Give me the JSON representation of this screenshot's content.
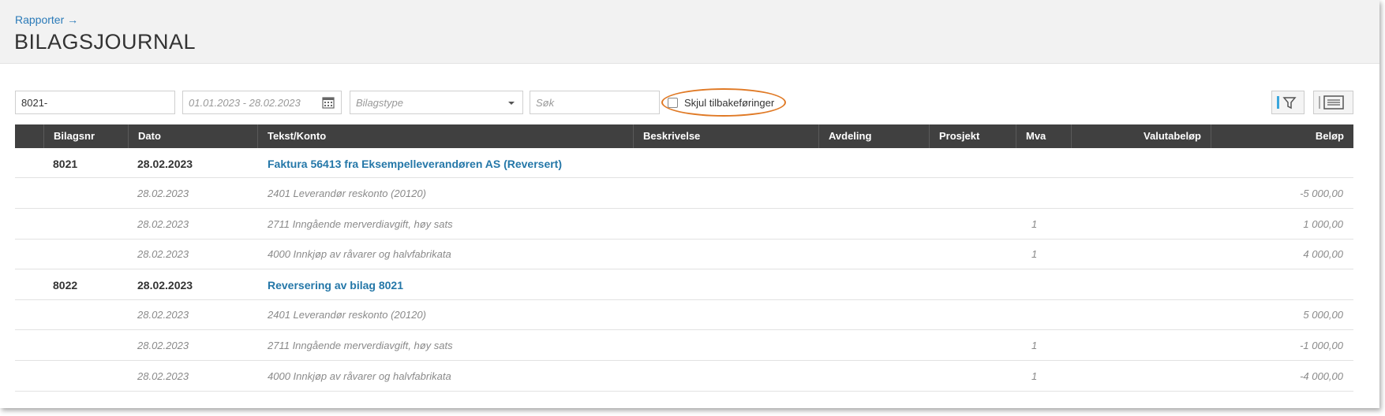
{
  "breadcrumb": "Rapporter →",
  "page_title": "BILAGSJOURNAL",
  "filters": {
    "bilagsnr_value": "8021-",
    "date_range_placeholder": "01.01.2023 - 28.02.2023",
    "bilagstype_placeholder": "Bilagstype",
    "search_placeholder": "Søk",
    "hide_reversals_label": "Skjul tilbakeføringer",
    "hide_reversals_checked": false
  },
  "columns": [
    "",
    "Bilagsnr",
    "Dato",
    "Tekst/Konto",
    "Beskrivelse",
    "Avdeling",
    "Prosjekt",
    "Mva",
    "Valutabeløp",
    "Beløp"
  ],
  "groups": [
    {
      "bilagsnr": "8021",
      "dato": "28.02.2023",
      "tekst": "Faktura 56413 fra Eksempelleverandøren AS (Reversert)",
      "lines": [
        {
          "dato": "28.02.2023",
          "konto": "2401 Leverandør reskonto (20120)",
          "mva": "",
          "belop": "-5 000,00"
        },
        {
          "dato": "28.02.2023",
          "konto": "2711 Inngående merverdiavgift, høy sats",
          "mva": "1",
          "belop": "1 000,00"
        },
        {
          "dato": "28.02.2023",
          "konto": "4000 Innkjøp av råvarer og halvfabrikata",
          "mva": "1",
          "belop": "4 000,00"
        }
      ]
    },
    {
      "bilagsnr": "8022",
      "dato": "28.02.2023",
      "tekst": "Reversering av bilag 8021",
      "lines": [
        {
          "dato": "28.02.2023",
          "konto": "2401 Leverandør reskonto (20120)",
          "mva": "",
          "belop": "5 000,00"
        },
        {
          "dato": "28.02.2023",
          "konto": "2711 Inngående merverdiavgift, høy sats",
          "mva": "1",
          "belop": "-1 000,00"
        },
        {
          "dato": "28.02.2023",
          "konto": "4000 Innkjøp av råvarer og halvfabrikata",
          "mva": "1",
          "belop": "-4 000,00"
        }
      ]
    }
  ],
  "colors": {
    "accent": "#2477a8",
    "header_bg": "#404040",
    "highlight": "#e07a26"
  }
}
